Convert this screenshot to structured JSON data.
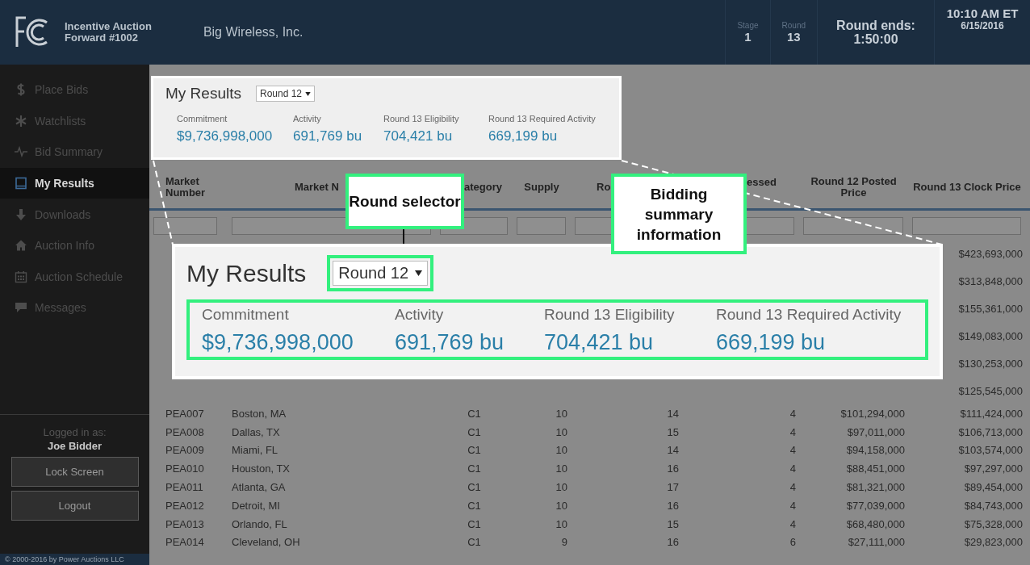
{
  "header": {
    "title_lines": [
      "Incentive Auction",
      "Forward #1002"
    ],
    "bidder": "Big Wireless, Inc.",
    "stats": [
      {
        "label": "Stage",
        "value": "1"
      },
      {
        "label": "Round",
        "value": "13"
      }
    ],
    "round_ends": {
      "label": "Round ends:",
      "value": "1:50:00"
    },
    "clock": {
      "time": "10:10 AM ET",
      "date": "6/15/2016"
    }
  },
  "sidebar": {
    "items": [
      {
        "label": "Place Bids",
        "selected": false
      },
      {
        "label": "Watchlists",
        "selected": false
      },
      {
        "label": "Bid Summary",
        "selected": false
      },
      {
        "label": "My Results",
        "selected": true
      },
      {
        "label": "Downloads",
        "selected": false
      },
      {
        "label": "Auction Info",
        "selected": false
      },
      {
        "label": "Auction Schedule",
        "selected": false
      },
      {
        "label": "Messages",
        "selected": false
      }
    ],
    "logged_in_label": "Logged in as:",
    "user": "Joe Bidder",
    "buttons": [
      "Lock Screen",
      "Logout"
    ],
    "footer": "© 2000-2016 by Power Auctions LLC"
  },
  "results_panel": {
    "title": "My Results",
    "round_select": "Round 12",
    "metrics": [
      {
        "label": "Commitment",
        "value": "$9,736,998,000"
      },
      {
        "label": "Activity",
        "value": "691,769 bu"
      },
      {
        "label": "Round 13 Eligibility",
        "value": "704,421 bu"
      },
      {
        "label": "Round 13 Required Activity",
        "value": "669,199 bu"
      }
    ]
  },
  "table": {
    "columns": [
      "Market Number",
      "Market N",
      "ategory",
      "Supply",
      "Ro",
      "essed",
      "Round 12 Posted Price",
      "Round 13 Clock Price"
    ],
    "rows": [
      {
        "cells": [
          null,
          null,
          null,
          null,
          null,
          null,
          null,
          "$423,693,000"
        ]
      },
      {
        "cells": [
          null,
          null,
          null,
          null,
          null,
          null,
          null,
          "$313,848,000"
        ]
      },
      {
        "cells": [
          null,
          null,
          null,
          null,
          null,
          null,
          null,
          "$155,361,000"
        ]
      },
      {
        "cells": [
          null,
          null,
          null,
          null,
          null,
          null,
          null,
          "$149,083,000"
        ]
      },
      {
        "cells": [
          null,
          null,
          null,
          null,
          null,
          null,
          null,
          "$130,253,000"
        ]
      },
      {
        "cells": [
          null,
          null,
          null,
          null,
          null,
          null,
          null,
          "$125,545,000"
        ]
      },
      {
        "cells": [
          "PEA007",
          "Boston, MA",
          "C1",
          "10",
          "14",
          "4",
          "$101,294,000",
          "$111,424,000"
        ]
      },
      {
        "cells": [
          "PEA008",
          "Dallas, TX",
          "C1",
          "10",
          "15",
          "4",
          "$97,011,000",
          "$106,713,000"
        ]
      },
      {
        "cells": [
          "PEA009",
          "Miami, FL",
          "C1",
          "10",
          "14",
          "4",
          "$94,158,000",
          "$103,574,000"
        ]
      },
      {
        "cells": [
          "PEA010",
          "Houston, TX",
          "C1",
          "10",
          "16",
          "4",
          "$88,451,000",
          "$97,297,000"
        ]
      },
      {
        "cells": [
          "PEA011",
          "Atlanta, GA",
          "C1",
          "10",
          "17",
          "4",
          "$81,321,000",
          "$89,454,000"
        ]
      },
      {
        "cells": [
          "PEA012",
          "Detroit, MI",
          "C1",
          "10",
          "16",
          "4",
          "$77,039,000",
          "$84,743,000"
        ]
      },
      {
        "cells": [
          "PEA013",
          "Orlando, FL",
          "C1",
          "10",
          "15",
          "4",
          "$68,480,000",
          "$75,328,000"
        ]
      },
      {
        "cells": [
          "PEA014",
          "Cleveland, OH",
          "C1",
          "9",
          "16",
          "6",
          "$27,111,000",
          "$29,823,000"
        ]
      }
    ]
  },
  "magnified_panel": {
    "title": "My Results",
    "round_select": "Round 12",
    "metrics": [
      {
        "label": "Commitment",
        "value": "$9,736,998,000"
      },
      {
        "label": "Activity",
        "value": "691,769 bu"
      },
      {
        "label": "Round 13 Eligibility",
        "value": "704,421 bu"
      },
      {
        "label": "Round 13 Required Activity",
        "value": "669,199 bu"
      }
    ]
  },
  "callouts": [
    {
      "text": "Round selector"
    },
    {
      "text": "Bidding summary information"
    }
  ]
}
